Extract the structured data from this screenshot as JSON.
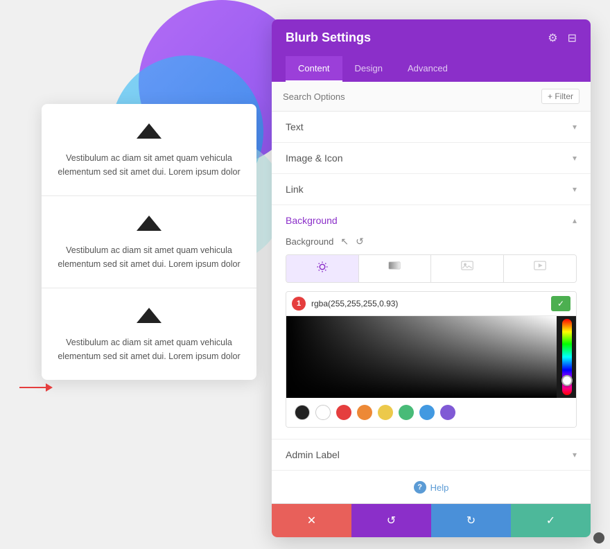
{
  "background": {
    "circles": {
      "purple": "purple",
      "blue": "blue",
      "teal": "teal"
    }
  },
  "left_panel": {
    "cards": [
      {
        "text": "Vestibulum ac diam sit amet quam vehicula elementum sed sit amet dui. Lorem ipsum dolor"
      },
      {
        "text": "Vestibulum ac diam sit amet quam vehicula elementum sed sit amet dui. Lorem ipsum dolor"
      },
      {
        "text": "Vestibulum ac diam sit amet quam vehicula elementum sed sit amet dui. Lorem ipsum dolor"
      }
    ]
  },
  "settings_panel": {
    "title": "Blurb Settings",
    "tabs": [
      {
        "label": "Content",
        "active": true
      },
      {
        "label": "Design",
        "active": false
      },
      {
        "label": "Advanced",
        "active": false
      }
    ],
    "search": {
      "placeholder": "Search Options",
      "filter_label": "+ Filter"
    },
    "sections": [
      {
        "label": "Text",
        "open": false
      },
      {
        "label": "Image & Icon",
        "open": false
      },
      {
        "label": "Link",
        "open": false
      },
      {
        "label": "Background",
        "open": true
      },
      {
        "label": "Admin Label",
        "open": false
      }
    ],
    "background": {
      "label": "Background",
      "color_value": "rgba(255,255,255,0.93)",
      "types": [
        {
          "label": "color",
          "icon": "🎨",
          "active": true
        },
        {
          "label": "gradient",
          "icon": "▭",
          "active": false
        },
        {
          "label": "image",
          "icon": "🖼",
          "active": false
        },
        {
          "label": "video",
          "icon": "▶",
          "active": false
        }
      ],
      "swatches": [
        {
          "color": "#222222"
        },
        {
          "color": "#ffffff"
        },
        {
          "color": "#e53e3e"
        },
        {
          "color": "#ed8936"
        },
        {
          "color": "#ecc94b"
        },
        {
          "color": "#48bb78"
        },
        {
          "color": "#4299e1"
        },
        {
          "color": "#805ad5"
        }
      ]
    },
    "help": {
      "label": "Help"
    },
    "toolbar": {
      "cancel_label": "✕",
      "reset_label": "↺",
      "redo_label": "↻",
      "save_label": "✓"
    }
  }
}
